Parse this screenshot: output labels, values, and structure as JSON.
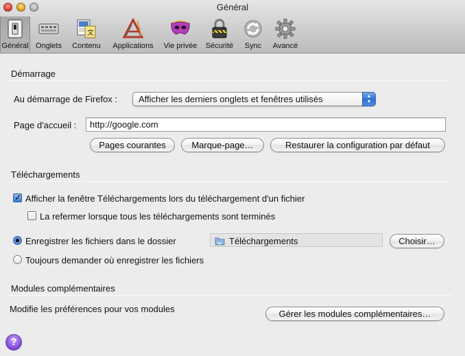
{
  "window": {
    "title": "Général"
  },
  "toolbar": {
    "items": [
      {
        "label": "Général",
        "icon": "general-switch-icon",
        "selected": true
      },
      {
        "label": "Onglets",
        "icon": "tabs-icon",
        "selected": false
      },
      {
        "label": "Contenu",
        "icon": "content-icon",
        "selected": false
      },
      {
        "label": "Applications",
        "icon": "applications-icon",
        "selected": false
      },
      {
        "label": "Vie privée",
        "icon": "privacy-mask-icon",
        "selected": false
      },
      {
        "label": "Sécurité",
        "icon": "security-lock-icon",
        "selected": false
      },
      {
        "label": "Sync",
        "icon": "sync-icon",
        "selected": false
      },
      {
        "label": "Avancé",
        "icon": "advanced-gear-icon",
        "selected": false
      }
    ]
  },
  "startup": {
    "section_title": "Démarrage",
    "on_start_label": "Au démarrage de Firefox :",
    "on_start_value": "Afficher les derniers onglets et fenêtres utilisés",
    "homepage_label": "Page d'accueil :",
    "homepage_value": "http://google.com",
    "btn_current_pages": "Pages courantes",
    "btn_bookmark": "Marque-page…",
    "btn_restore_default": "Restaurer la configuration par défaut"
  },
  "downloads": {
    "section_title": "Téléchargements",
    "show_window_label": "Afficher la fenêtre Téléchargements lors du téléchargement d'un fichier",
    "show_window_checked": true,
    "close_when_done_label": "La refermer lorsque tous les téléchargements sont terminés",
    "close_when_done_checked": false,
    "save_to_label": "Enregistrer les fichiers dans le dossier",
    "save_to_selected": true,
    "folder_value": "Téléchargements",
    "btn_choose": "Choisir…",
    "always_ask_label": "Toujours demander où enregistrer les fichiers",
    "always_ask_selected": false
  },
  "addons": {
    "section_title": "Modules complémentaires",
    "description": "Modifie les préférences pour vos modules",
    "btn_manage": "Gérer les modules complémentaires…"
  },
  "help": {
    "label": "?"
  },
  "colors": {
    "accent_blue": "#3b78d8",
    "help_purple": "#7a42d8",
    "background": "#ececec"
  }
}
